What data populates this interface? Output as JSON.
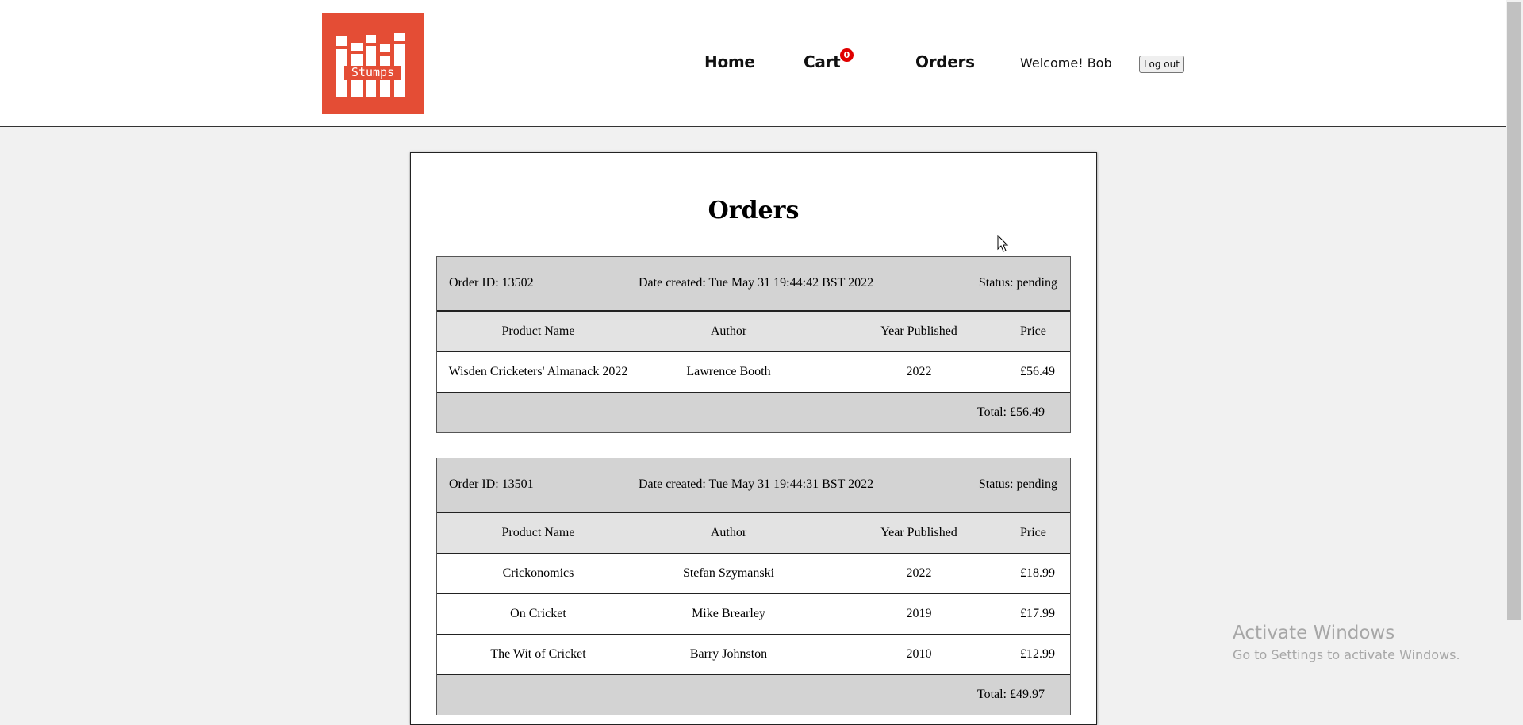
{
  "logo": {
    "text": "Stumps",
    "bg_color": "#e44d35"
  },
  "nav": {
    "home": "Home",
    "cart": "Cart",
    "cart_count": "0",
    "orders": "Orders",
    "welcome": "Welcome! Bob",
    "logout": "Log out"
  },
  "page": {
    "title": "Orders"
  },
  "columns": {
    "product": "Product Name",
    "author": "Author",
    "year": "Year Published",
    "price": "Price"
  },
  "orders": [
    {
      "id": "Order ID: 13502",
      "date": "Date created: Tue May 31 19:44:42 BST 2022",
      "status": "Status: pending",
      "items": [
        {
          "name": "Wisden Cricketers' Almanack 2022",
          "author": "Lawrence Booth",
          "year": "2022",
          "price": "£56.49"
        }
      ],
      "total": "Total: £56.49"
    },
    {
      "id": "Order ID: 13501",
      "date": "Date created: Tue May 31 19:44:31 BST 2022",
      "status": "Status: pending",
      "items": [
        {
          "name": "Crickonomics",
          "author": "Stefan Szymanski",
          "year": "2022",
          "price": "£18.99"
        },
        {
          "name": "On Cricket",
          "author": "Mike Brearley",
          "year": "2019",
          "price": "£17.99"
        },
        {
          "name": "The Wit of Cricket",
          "author": "Barry Johnston",
          "year": "2010",
          "price": "£12.99"
        }
      ],
      "total": "Total: £49.97"
    }
  ],
  "watermark": {
    "line1": "Activate Windows",
    "line2": "Go to Settings to activate Windows."
  }
}
